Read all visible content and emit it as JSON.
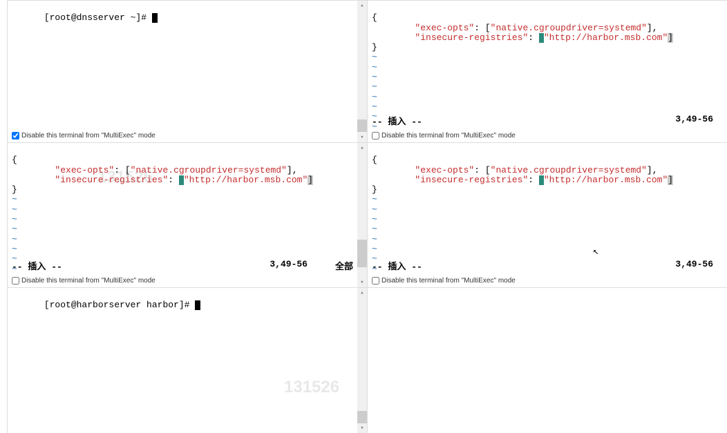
{
  "checkbox_label": "Disable this terminal from \"MultiExec\" mode",
  "panes": {
    "tl": {
      "prompt": "[root@dnsserver ~]# ",
      "checkbox_checked": true
    },
    "tr": {
      "lines": {
        "open_brace": "{",
        "indent": "        ",
        "key1": "\"exec-opts\"",
        "val1_open": ": [",
        "val1_str": "\"native.cgroupdriver=systemd\"",
        "val1_close": "],",
        "key2": "\"insecure-registries\"",
        "val2_open": ": ",
        "val2_bracket": "[",
        "val2_str": "\"http://harbor.msb.com\"",
        "val2_close": "]",
        "close_brace": "}"
      },
      "status_left": "-- 插入 --",
      "status_pos": "3,49-56",
      "checkbox_checked": false
    },
    "ml": {
      "lines": {
        "open_brace": "{",
        "indent": "        ",
        "key1": "\"exec-opts\"",
        "val1_open": ": [",
        "val1_str": "\"native.cgroupdriver=systemd\"",
        "val1_close": "],",
        "key2": "\"insecure-registries\"",
        "val2_open": ": ",
        "val2_bracket": "[",
        "val2_str": "\"http://harbor.msb.com\"",
        "val2_close": "]",
        "close_brace": "}"
      },
      "status_left": "-- 插入 --",
      "status_pos": "3,49-56",
      "status_extra": "全部",
      "checkbox_checked": false
    },
    "mr": {
      "lines": {
        "open_brace": "{",
        "indent": "        ",
        "key1": "\"exec-opts\"",
        "val1_open": ": [",
        "val1_str": "\"native.cgroupdriver=systemd\"",
        "val1_close": "],",
        "key2": "\"insecure-registries\"",
        "val2_open": ": ",
        "val2_bracket": "[",
        "val2_str": "\"http://harbor.msb.com\"",
        "val2_close": "]",
        "close_brace": "}"
      },
      "status_left": "-- 插入 --",
      "status_pos": "3,49-56",
      "checkbox_checked": false
    },
    "bl": {
      "prompt": "[root@harborserver harbor]# "
    }
  },
  "tilde": "~",
  "watermark1": "131526",
  "watermark2": "131526"
}
